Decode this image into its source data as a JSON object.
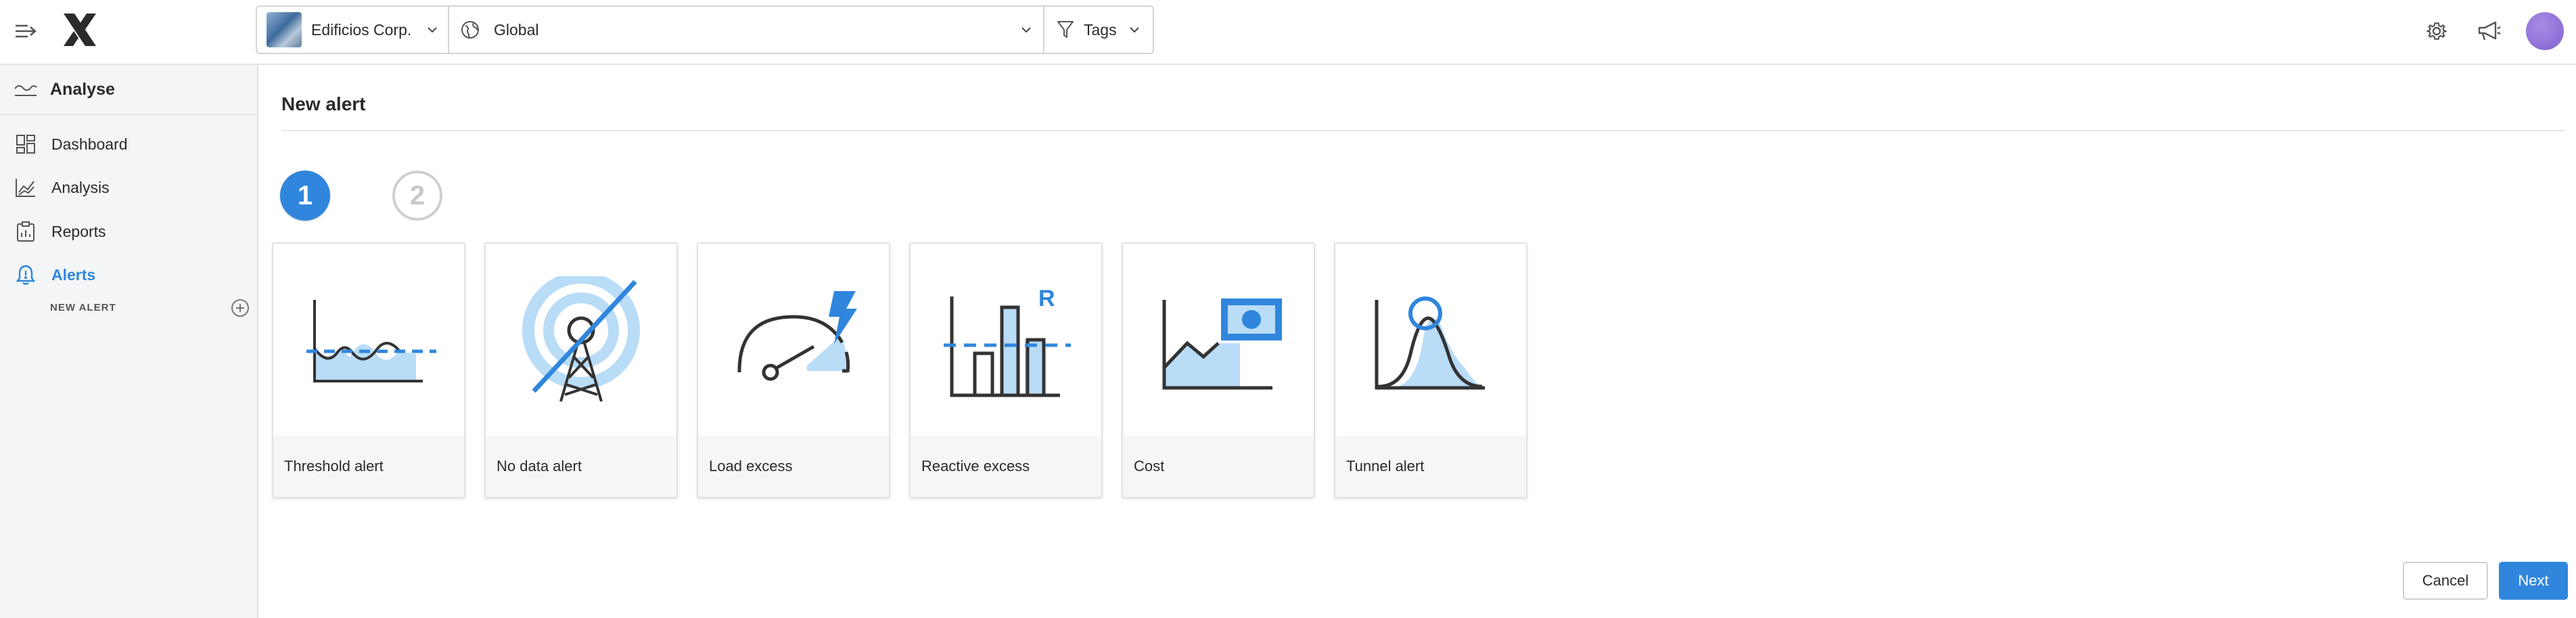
{
  "header": {
    "company": "Edificios Corp.",
    "region": "Global",
    "tags_label": "Tags",
    "icons": [
      "menu-toggle-icon",
      "logo",
      "settings-gear-icon",
      "megaphone-icon",
      "user-avatar"
    ]
  },
  "sidebar": {
    "section_title": "Analyse",
    "items": [
      {
        "label": "Dashboard",
        "icon": "dashboard-icon",
        "active": false
      },
      {
        "label": "Analysis",
        "icon": "line-chart-icon",
        "active": false
      },
      {
        "label": "Reports",
        "icon": "clipboard-icon",
        "active": false
      },
      {
        "label": "Alerts",
        "icon": "bell-icon",
        "active": true
      }
    ],
    "sub_item": "NEW ALERT"
  },
  "main": {
    "title": "New alert",
    "steps": [
      "1",
      "2"
    ],
    "current_step": "1",
    "alert_types": [
      {
        "label": "Threshold alert",
        "icon": "threshold-alert-icon"
      },
      {
        "label": "No data alert",
        "icon": "no-data-tower-icon"
      },
      {
        "label": "Load excess",
        "icon": "gauge-lightning-icon"
      },
      {
        "label": "Reactive excess",
        "icon": "reactive-bars-icon",
        "badge": "R"
      },
      {
        "label": "Cost",
        "icon": "cost-money-icon"
      },
      {
        "label": "Tunnel alert",
        "icon": "tunnel-curve-icon"
      }
    ],
    "buttons": {
      "cancel": "Cancel",
      "next": "Next"
    }
  },
  "colors": {
    "accent": "#2f86dc",
    "accent_light": "#b9dcf7",
    "icon_dark": "#333333",
    "sidebar_bg": "#f4f5f7",
    "avatar": "#8a6fd6"
  }
}
